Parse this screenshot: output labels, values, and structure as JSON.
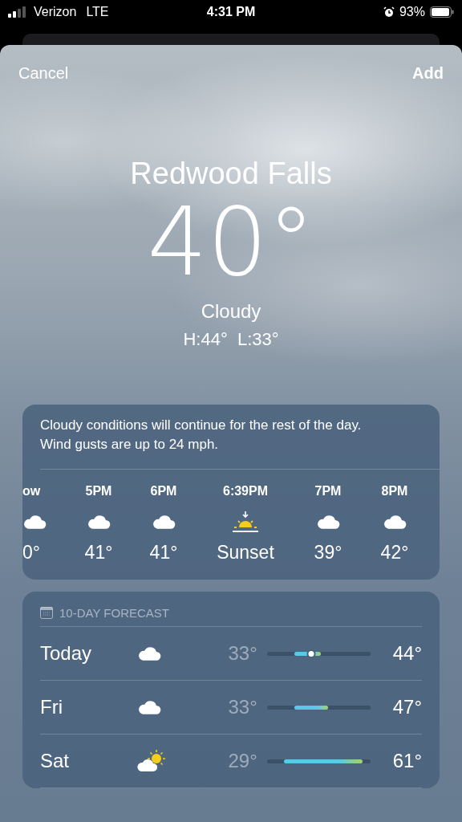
{
  "status_bar": {
    "carrier": "Verizon",
    "network": "LTE",
    "time": "4:31 PM",
    "alarm": true,
    "battery": "93%"
  },
  "nav": {
    "cancel": "Cancel",
    "add": "Add"
  },
  "current": {
    "city": "Redwood Falls",
    "temperature": "40°",
    "condition": "Cloudy",
    "high_low": "H:44°  L:33°"
  },
  "hourly": {
    "summary": "Cloudy conditions will continue for the rest of the day. Wind gusts are up to 24 mph.",
    "hours": [
      {
        "time": "ow",
        "kind": "cloud",
        "value": "0°"
      },
      {
        "time": "5PM",
        "kind": "cloud",
        "value": "41°"
      },
      {
        "time": "6PM",
        "kind": "cloud",
        "value": "41°"
      },
      {
        "time": "6:39PM",
        "kind": "sunset",
        "value": "Sunset"
      },
      {
        "time": "7PM",
        "kind": "cloud",
        "value": "39°"
      },
      {
        "time": "8PM",
        "kind": "cloud",
        "value": "42°"
      }
    ]
  },
  "forecast": {
    "title": "10-DAY FORECAST",
    "days": [
      {
        "day": "Today",
        "kind": "cloud",
        "low": "33°",
        "high": "44°",
        "now": true
      },
      {
        "day": "Fri",
        "kind": "cloud",
        "low": "33°",
        "high": "47°",
        "now": false
      },
      {
        "day": "Sat",
        "kind": "partly-sunny",
        "low": "29°",
        "high": "61°",
        "now": false
      }
    ]
  }
}
